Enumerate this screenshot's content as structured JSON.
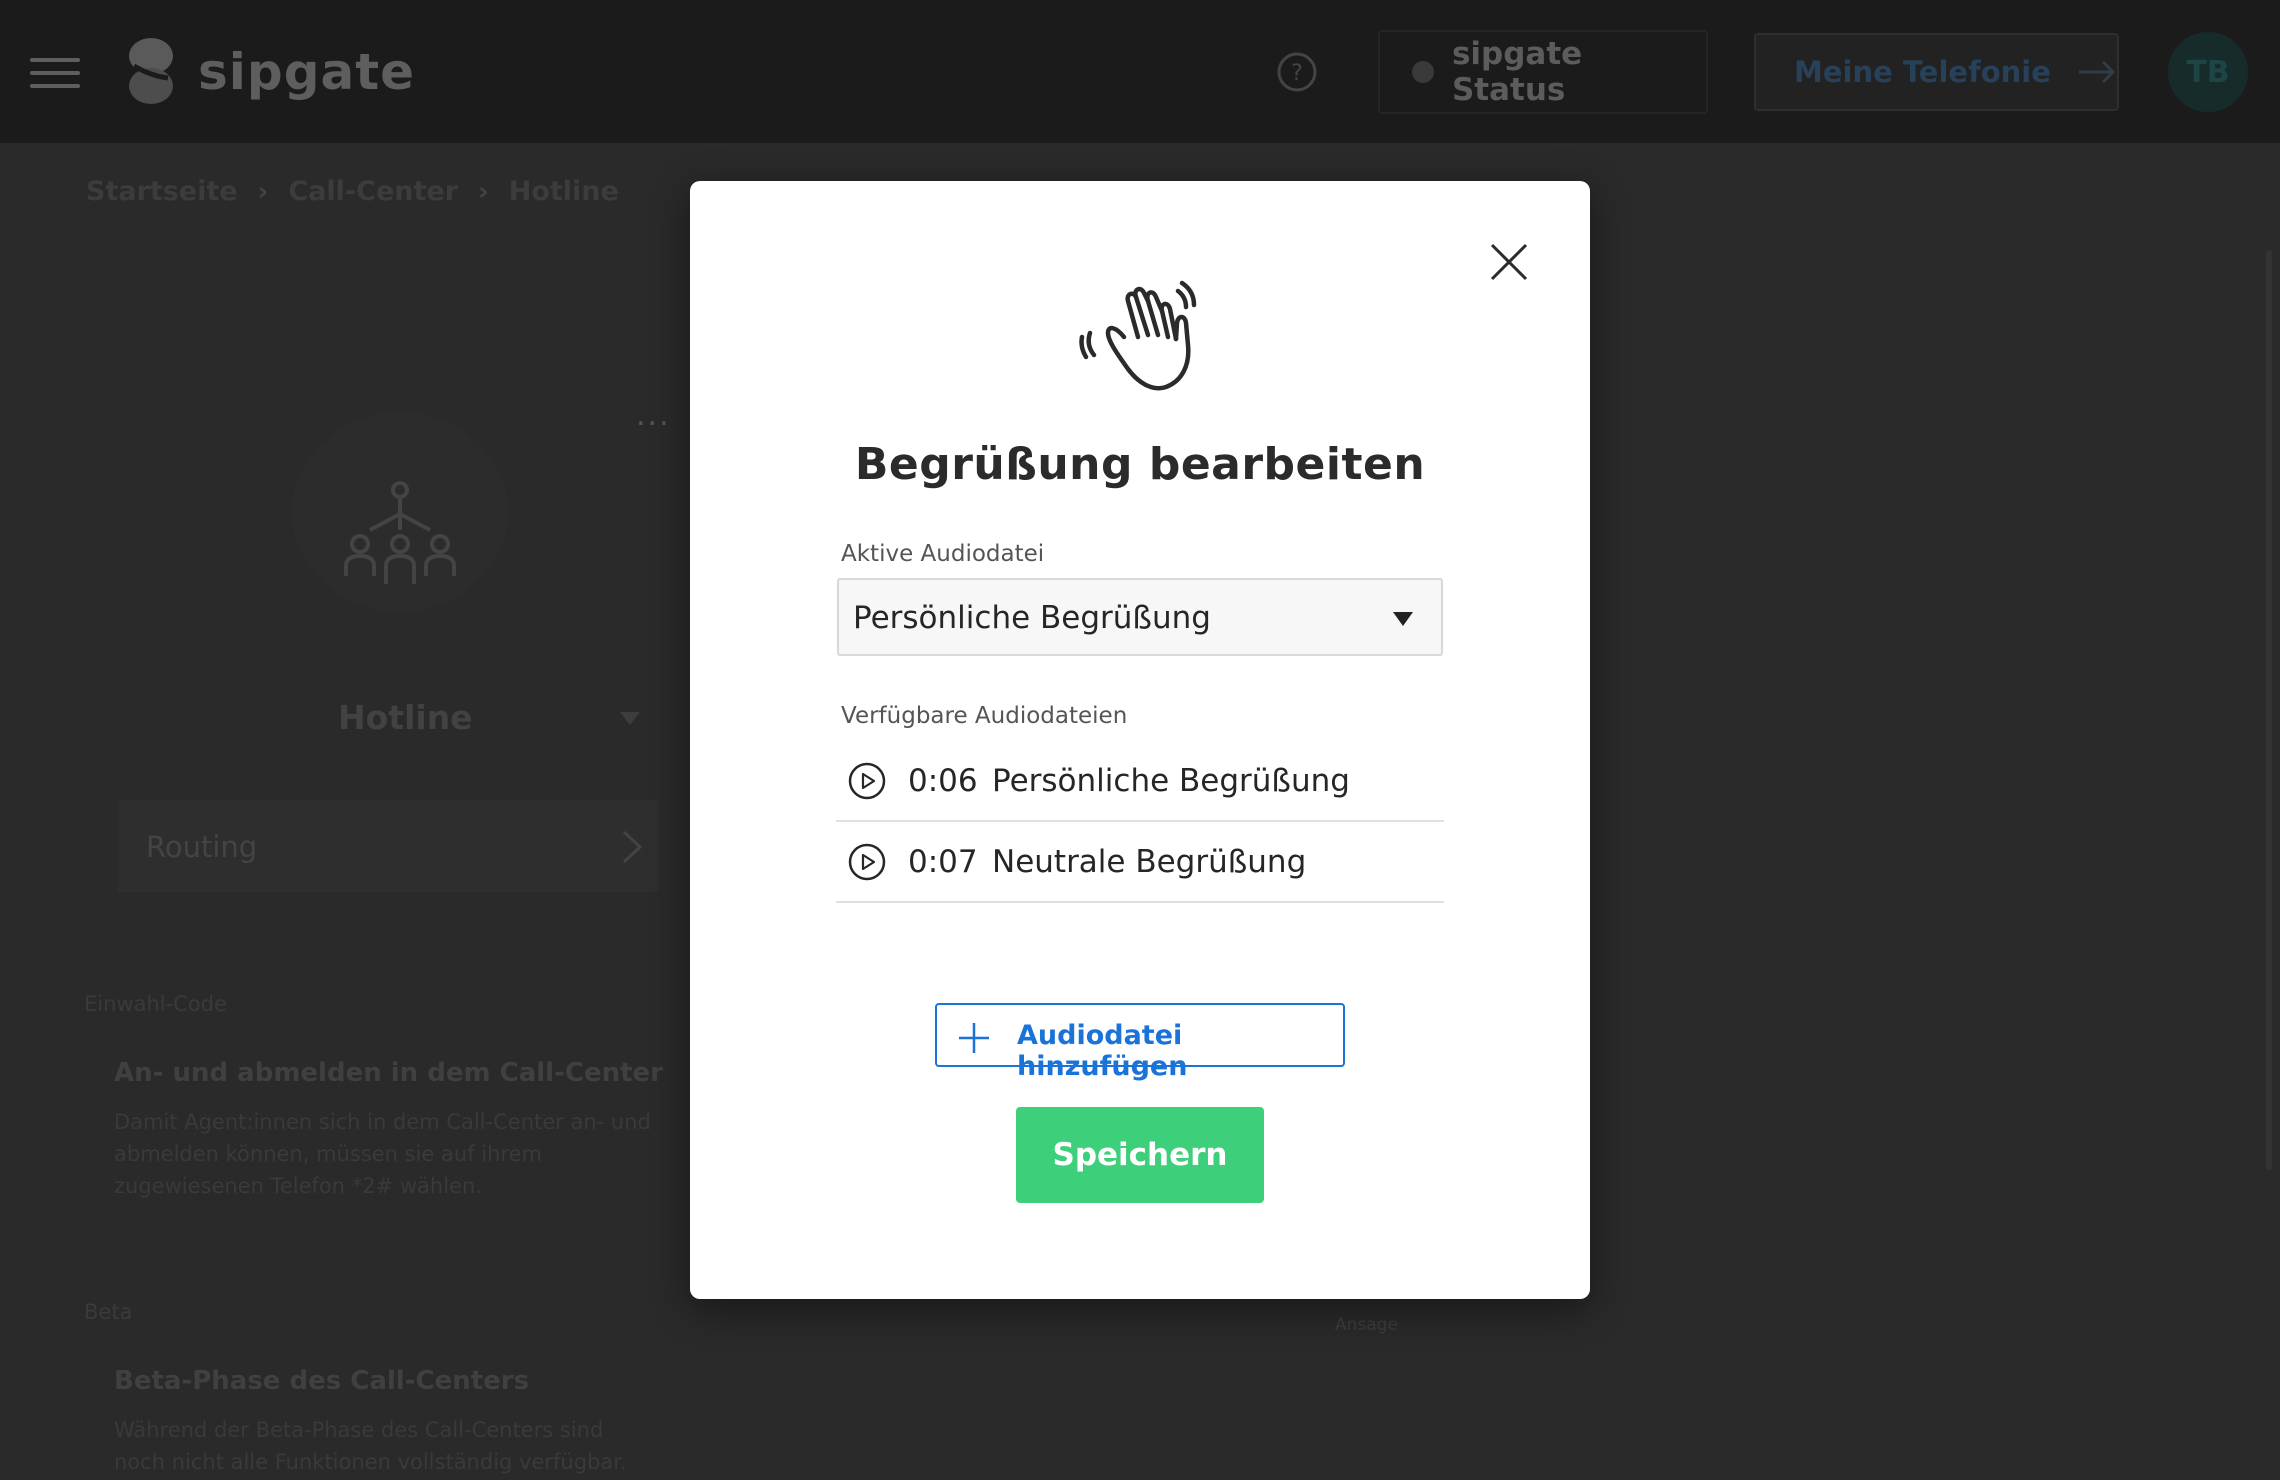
{
  "header": {
    "brand": "sipgate",
    "status_label": "sipgate Status",
    "telefonie_label": "Meine Telefonie",
    "avatar_initials": "TB"
  },
  "breadcrumb": [
    "Startseite",
    "Call-Center",
    "Hotline"
  ],
  "background": {
    "more_label": "...",
    "hotline_label": "Hotline",
    "routing_label": "Routing",
    "einwahl": {
      "section": "Einwahl-Code",
      "title": "An- und abmelden in dem Call-Center",
      "text_lines": [
        "Damit Agent:innen sich in dem Call-Center an- und",
        "abmelden können, müssen sie auf ihrem",
        "zugewiesenen Telefon *2# wählen."
      ]
    },
    "beta": {
      "section": "Beta",
      "title": "Beta-Phase des Call-Centers",
      "text_lines": [
        "Während der Beta-Phase des Call-Centers sind",
        "noch nicht alle Funktionen vollständig verfügbar."
      ]
    },
    "ansage_label": "Ansage"
  },
  "modal": {
    "title": "Begrüßung bearbeiten",
    "active_label": "Aktive Audiodatei",
    "active_value": "Persönliche Begrüßung",
    "available_label": "Verfügbare Audiodateien",
    "files": [
      {
        "duration": "0:06",
        "name": "Persönliche Begrüßung"
      },
      {
        "duration": "0:07",
        "name": "Neutrale Begrüßung"
      }
    ],
    "add_label": "Audiodatei hinzufügen",
    "save_label": "Speichern"
  },
  "colors": {
    "accent_blue": "#1a73d8",
    "save_green": "#3ecf7b"
  },
  "icons": [
    "menu-icon",
    "sipgate-logo-icon",
    "help-icon",
    "status-dot-icon",
    "arrow-right-icon",
    "team-routing-icon",
    "chevron-right-icon",
    "close-icon",
    "waving-hand-icon",
    "play-icon",
    "plus-icon",
    "dropdown-caret-icon"
  ]
}
